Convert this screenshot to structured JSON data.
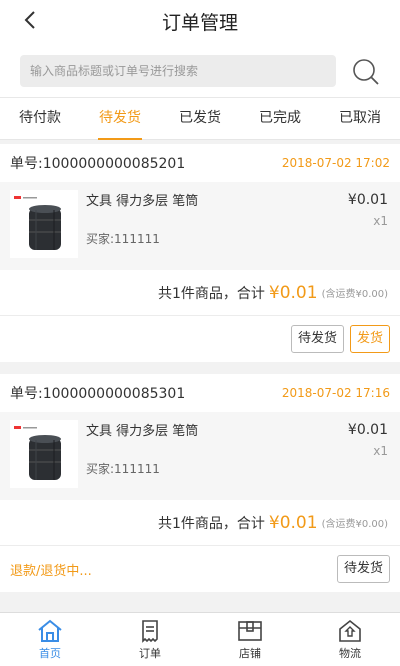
{
  "header": {
    "title": "订单管理"
  },
  "search": {
    "placeholder": "输入商品标题或订单号进行搜索"
  },
  "tabs": [
    {
      "label": "待付款",
      "active": false
    },
    {
      "label": "待发货",
      "active": true
    },
    {
      "label": "已发货",
      "active": false
    },
    {
      "label": "已完成",
      "active": false
    },
    {
      "label": "已取消",
      "active": false
    }
  ],
  "orders": [
    {
      "order_no": "单号:1000000000085201",
      "time": "2018-07-02 17:02",
      "item": {
        "name": "文具 得力多层 笔筒",
        "buyer": "买家:111111",
        "price": "¥0.01",
        "qty": "x1"
      },
      "summary": {
        "count_text": "共1件商品，合计",
        "total": "¥0.01",
        "shipping": "(含运费¥0.00)"
      },
      "actions": {
        "status_button": "待发货",
        "ship_button": "发货"
      }
    },
    {
      "order_no": "单号:1000000000085301",
      "time": "2018-07-02 17:16",
      "item": {
        "name": "文具 得力多层 笔筒",
        "buyer": "买家:111111",
        "price": "¥0.01",
        "qty": "x1"
      },
      "summary": {
        "count_text": "共1件商品，合计",
        "total": "¥0.01",
        "shipping": "(含运费¥0.00)"
      },
      "actions": {
        "refund_text": "退款/退货中...",
        "status_button": "待发货"
      }
    }
  ],
  "tabbar": [
    {
      "label": "首页",
      "icon": "home-icon",
      "active": true
    },
    {
      "label": "订单",
      "icon": "orders-icon",
      "active": false
    },
    {
      "label": "店铺",
      "icon": "store-icon",
      "active": false
    },
    {
      "label": "物流",
      "icon": "logistics-icon",
      "active": false
    }
  ],
  "colors": {
    "accent": "#f29a18",
    "active_nav": "#3a8de6"
  }
}
